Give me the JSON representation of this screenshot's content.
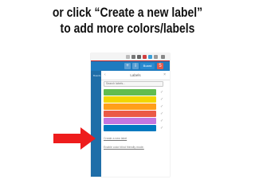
{
  "caption": {
    "line1": "or click “Create a new label”",
    "line2": "to add more colors/labels"
  },
  "board_bar": {
    "notifications_count": "5",
    "pill_label": "Board"
  },
  "sidebar": {
    "label": "Boards"
  },
  "labels_panel": {
    "back_icon": "chevron-left-icon",
    "title": "Labels",
    "close_icon": "close-icon",
    "search_placeholder": "Search labels...",
    "labels": [
      {
        "color": "#61bd4f",
        "selected": true
      },
      {
        "color": "#f2d600",
        "selected": true
      },
      {
        "color": "#ff9f1a",
        "selected": true
      },
      {
        "color": "#eb5a46",
        "selected": true
      },
      {
        "color": "#c377e0",
        "selected": true
      },
      {
        "color": "#0079bf",
        "selected": true
      }
    ],
    "create_link": "Create a new label",
    "colorblind_link": "Enable color blind friendly mode."
  },
  "annotation": {
    "arrow_color": "#ee1c1c"
  }
}
